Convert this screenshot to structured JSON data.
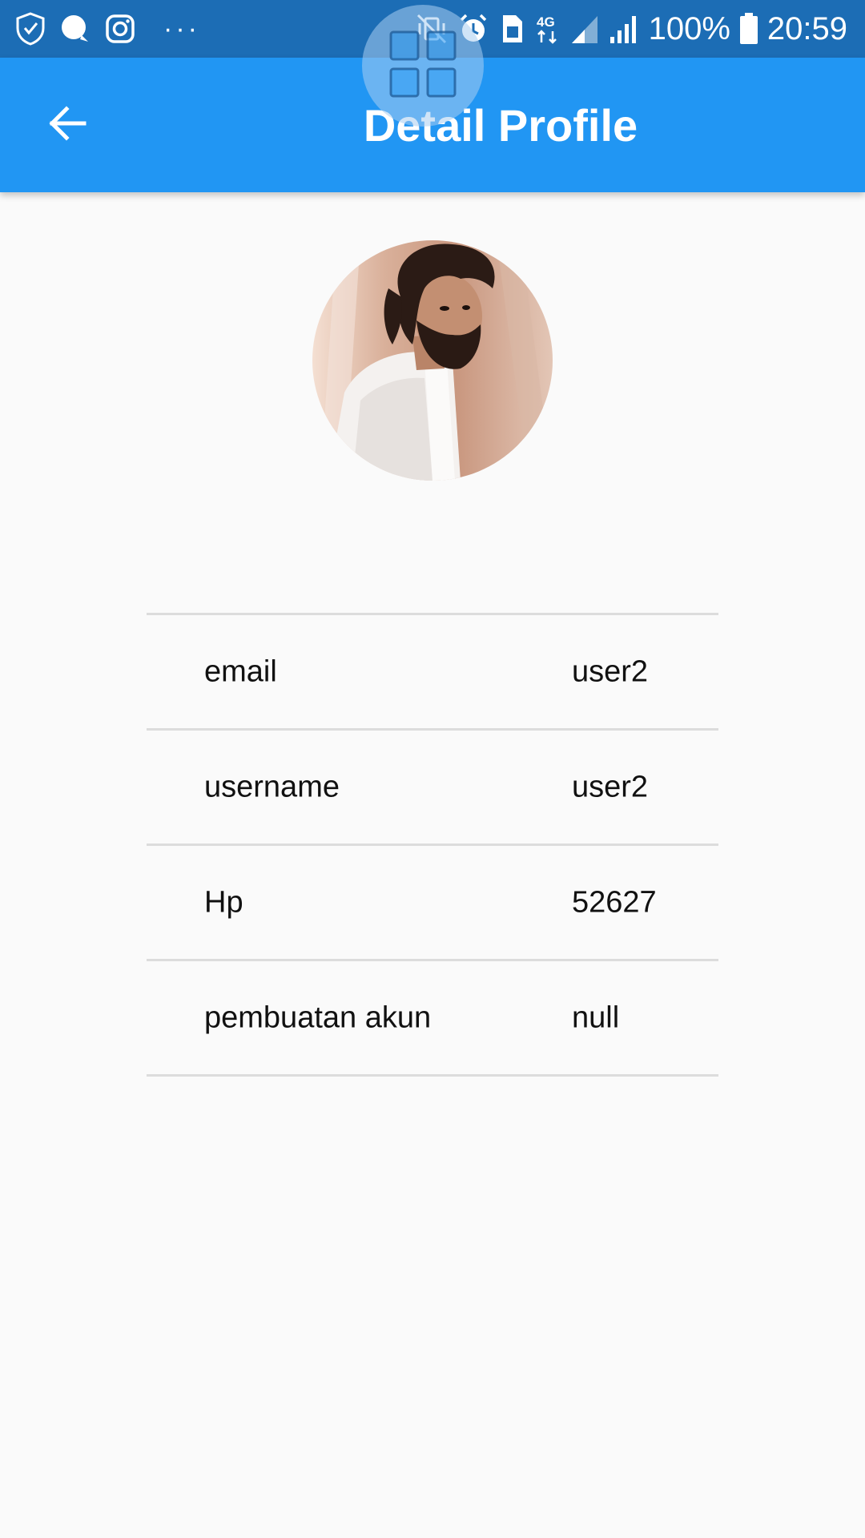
{
  "status_bar": {
    "left_icons": [
      "shield-icon",
      "chat-bubble-icon",
      "instagram-icon"
    ],
    "overflow": "···",
    "battery_text": "100%",
    "time": "20:59",
    "network": "4G",
    "colors": {
      "background": "#1c6db5"
    }
  },
  "app_bar": {
    "title": "Detail Profile",
    "back_icon": "arrow-back-icon",
    "colors": {
      "background": "#2196f3"
    }
  },
  "overlay": {
    "icon": "grid-icon"
  },
  "profile": {
    "avatar_icon": "avatar"
  },
  "info_rows": [
    {
      "label": "email",
      "value": "user2"
    },
    {
      "label": "username",
      "value": "user2"
    },
    {
      "label": "Hp",
      "value": "52627"
    },
    {
      "label": "pembuatan akun",
      "value": "null"
    }
  ]
}
